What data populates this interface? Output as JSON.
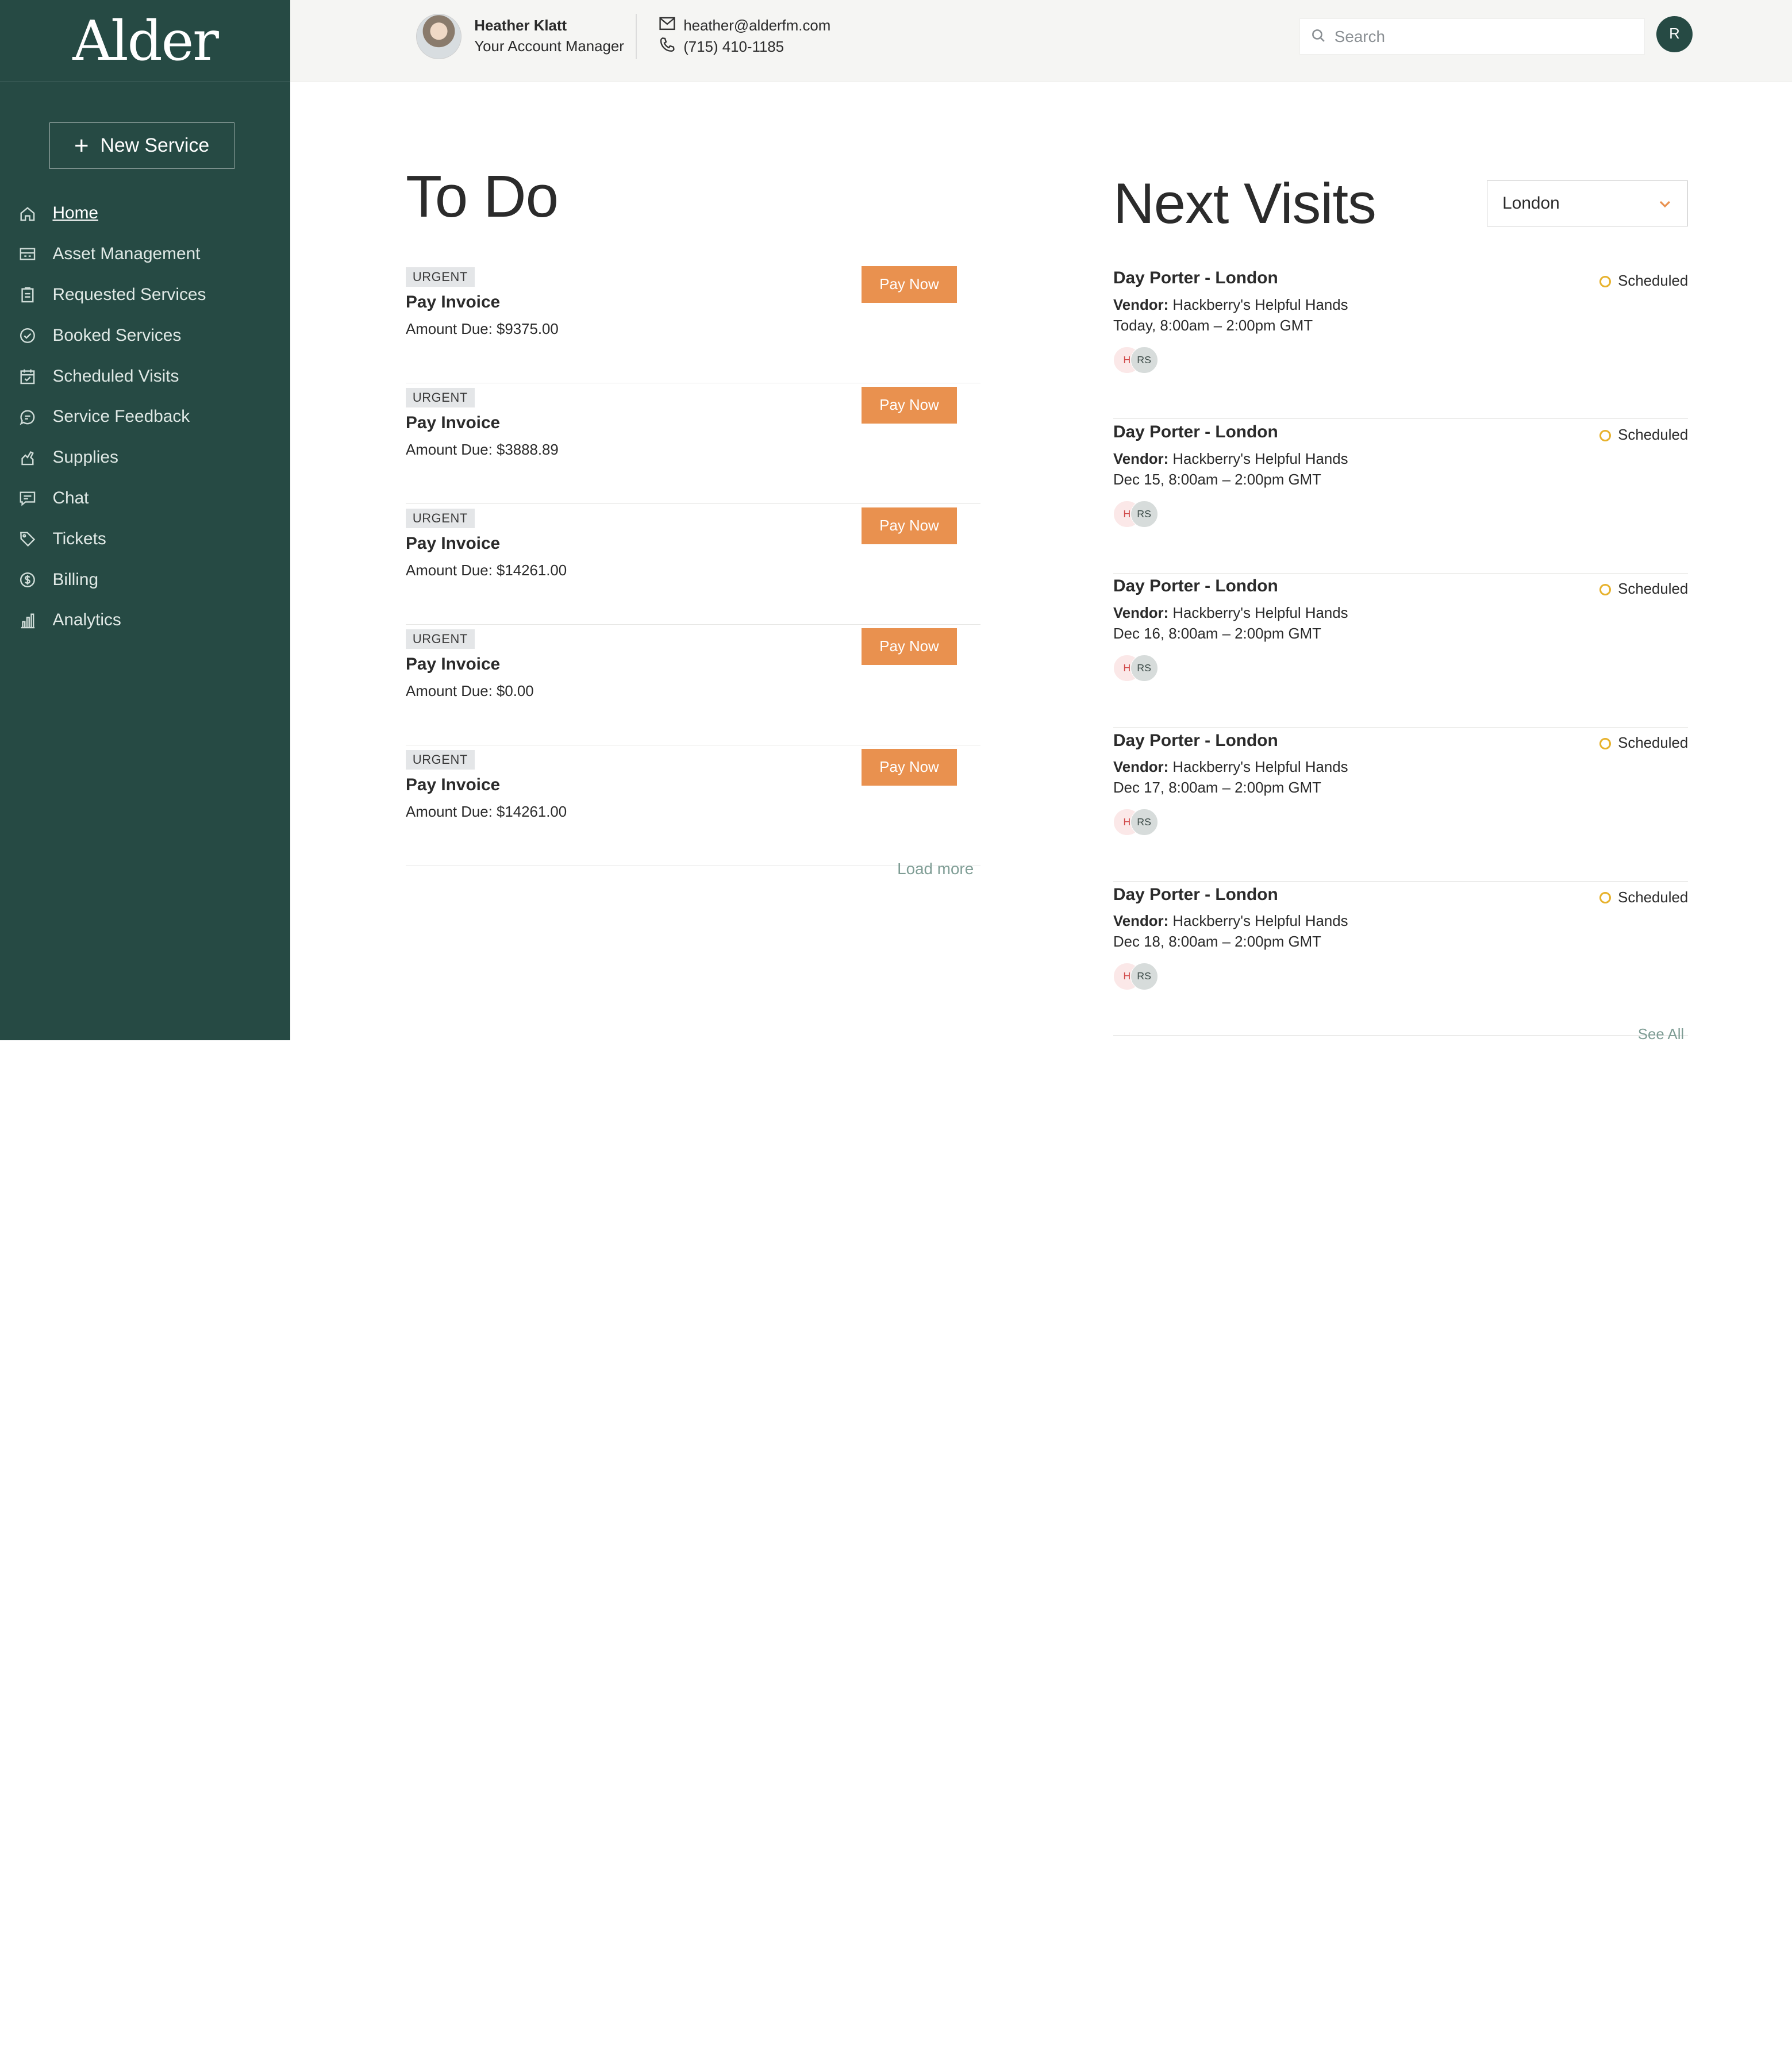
{
  "sidebar": {
    "logo": "Alder",
    "new_service": "New Service",
    "items": [
      {
        "label": "Home",
        "icon": "home-icon",
        "active": true
      },
      {
        "label": "Asset Management",
        "icon": "asset-icon"
      },
      {
        "label": "Requested Services",
        "icon": "clipboard-icon"
      },
      {
        "label": "Booked Services",
        "icon": "check-circle-icon"
      },
      {
        "label": "Scheduled Visits",
        "icon": "calendar-check-icon"
      },
      {
        "label": "Service Feedback",
        "icon": "feedback-icon"
      },
      {
        "label": "Supplies",
        "icon": "supplies-icon"
      },
      {
        "label": "Chat",
        "icon": "chat-icon"
      },
      {
        "label": "Tickets",
        "icon": "tag-icon"
      },
      {
        "label": "Billing",
        "icon": "dollar-icon"
      },
      {
        "label": "Analytics",
        "icon": "bar-chart-icon"
      }
    ]
  },
  "header": {
    "manager_name": "Heather Klatt",
    "manager_role": "Your Account Manager",
    "email": "heather@alderfm.com",
    "phone": "(715) 410-1185",
    "search_placeholder": "Search",
    "user_initial": "R"
  },
  "todo": {
    "title": "To Do",
    "load_more": "Load more",
    "items": [
      {
        "badge": "URGENT",
        "title": "Pay Invoice",
        "amount": "Amount Due: $9375.00",
        "action": "Pay Now"
      },
      {
        "badge": "URGENT",
        "title": "Pay Invoice",
        "amount": "Amount Due: $3888.89",
        "action": "Pay Now"
      },
      {
        "badge": "URGENT",
        "title": "Pay Invoice",
        "amount": "Amount Due: $14261.00",
        "action": "Pay Now"
      },
      {
        "badge": "URGENT",
        "title": "Pay Invoice",
        "amount": "Amount Due: $0.00",
        "action": "Pay Now"
      },
      {
        "badge": "URGENT",
        "title": "Pay Invoice",
        "amount": "Amount Due: $14261.00",
        "action": "Pay Now"
      }
    ]
  },
  "visits": {
    "title": "Next Visits",
    "location": "London",
    "see_all": "See All",
    "vendor_label": "Vendor:",
    "items": [
      {
        "title": "Day Porter - London",
        "vendor": "Hackberry's Helpful Hands",
        "when": "Today,  8:00am – 2:00pm GMT",
        "status": "Scheduled",
        "chip1": "H",
        "chip2": "RS"
      },
      {
        "title": "Day Porter - London",
        "vendor": "Hackberry's Helpful Hands",
        "when": "Dec 15,  8:00am – 2:00pm GMT",
        "status": "Scheduled",
        "chip1": "H",
        "chip2": "RS"
      },
      {
        "title": "Day Porter - London",
        "vendor": "Hackberry's Helpful Hands",
        "when": "Dec 16,  8:00am – 2:00pm GMT",
        "status": "Scheduled",
        "chip1": "H",
        "chip2": "RS"
      },
      {
        "title": "Day Porter - London",
        "vendor": "Hackberry's Helpful Hands",
        "when": "Dec 17,  8:00am – 2:00pm GMT",
        "status": "Scheduled",
        "chip1": "H",
        "chip2": "RS"
      },
      {
        "title": "Day Porter - London",
        "vendor": "Hackberry's Helpful Hands",
        "when": "Dec 18,  8:00am – 2:00pm GMT",
        "status": "Scheduled",
        "chip1": "H",
        "chip2": "RS"
      }
    ]
  },
  "colors": {
    "sidebar_bg": "#264a44",
    "accent_orange": "#e9914f",
    "status_scheduled": "#e7b22d",
    "link_muted": "#7f9d95"
  }
}
